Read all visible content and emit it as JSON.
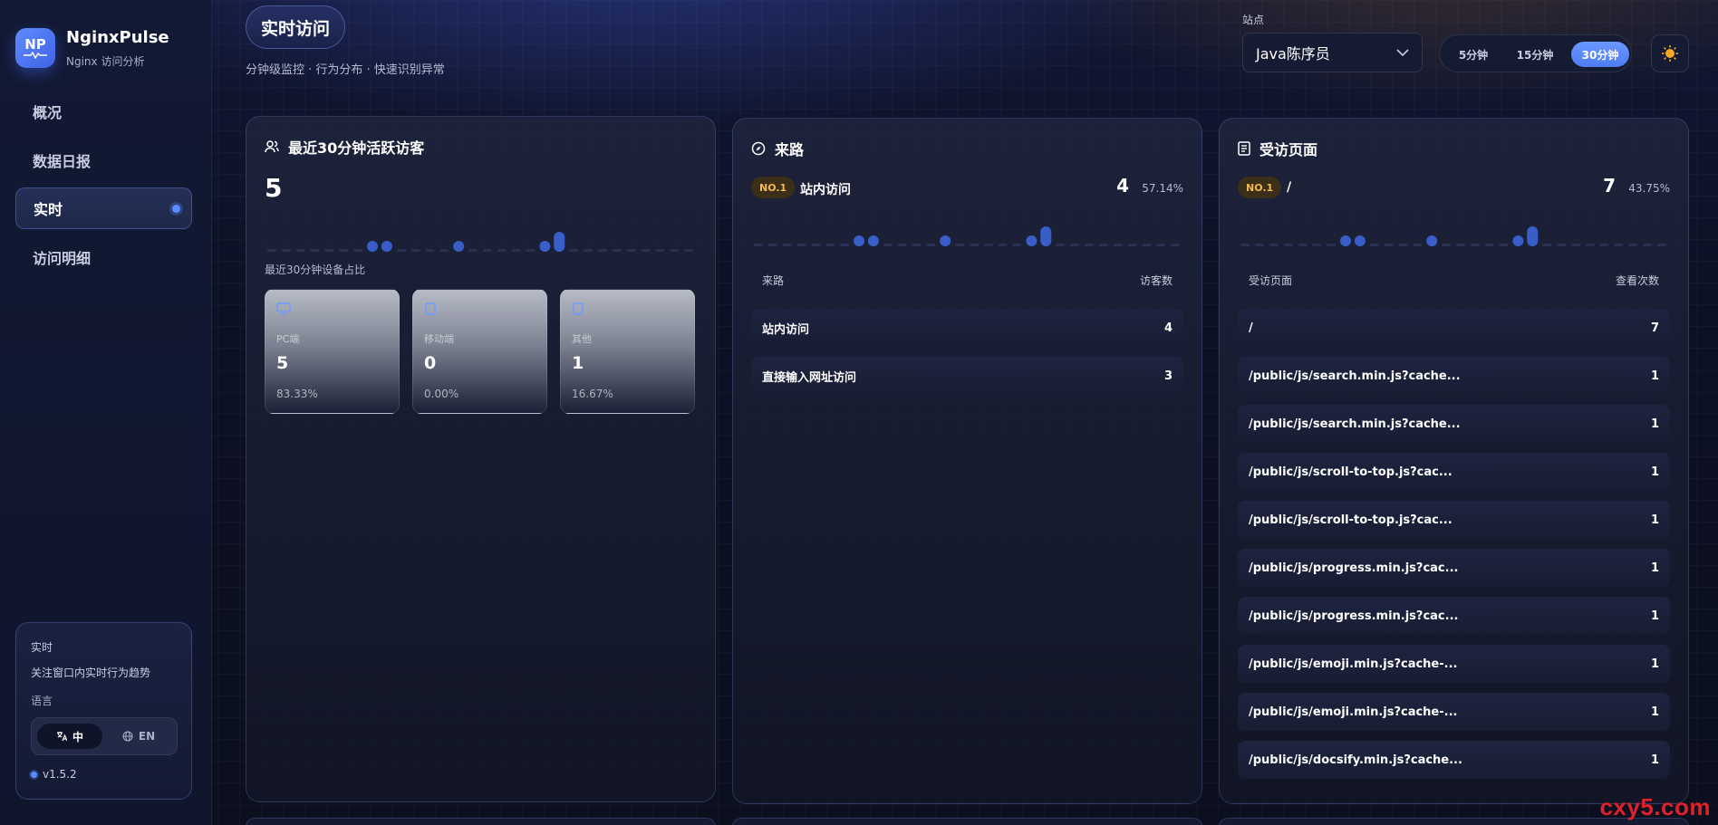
{
  "app": {
    "logo_abbr": "NP",
    "title": "NginxPulse",
    "subtitle": "Nginx 访问分析"
  },
  "nav": [
    {
      "label": "概况"
    },
    {
      "label": "数据日报"
    },
    {
      "label": "实时"
    },
    {
      "label": "访问明细"
    }
  ],
  "side_panel": {
    "title": "实时",
    "description": "关注窗口内实时行为趋势",
    "language_label": "语言",
    "lang_zh": "中",
    "lang_en": "EN",
    "version": "v1.5.2"
  },
  "header": {
    "title": "实时访问",
    "subtitle": "分钟级监控 · 行为分布 · 快速识别异常",
    "site_label": "站点",
    "site_value": "Java陈序员",
    "ranges": [
      "5分钟",
      "15分钟",
      "30分钟"
    ],
    "active_range": "30分钟"
  },
  "visitors_card": {
    "title": "最近30分钟活跃访客",
    "count": "5",
    "device_label": "最近30分钟设备占比",
    "devices": [
      {
        "label": "PC端",
        "count": "5",
        "pct": "83.33%"
      },
      {
        "label": "移动端",
        "count": "0",
        "pct": "0.00%"
      },
      {
        "label": "其他",
        "count": "1",
        "pct": "16.67%"
      }
    ]
  },
  "referrer_card": {
    "title": "来路",
    "top_badge": "NO.1",
    "top_name": "站内访问",
    "top_value": "4",
    "top_pct": "57.14%",
    "col_name": "来路",
    "col_value": "访客数",
    "rows": [
      {
        "name": "站内访问",
        "value": "4"
      },
      {
        "name": "直接输入网址访问",
        "value": "3"
      }
    ]
  },
  "pages_card": {
    "title": "受访页面",
    "top_badge": "NO.1",
    "top_name": "/",
    "top_value": "7",
    "top_pct": "43.75%",
    "col_name": "受访页面",
    "col_value": "查看次数",
    "rows": [
      {
        "name": "/",
        "value": "7"
      },
      {
        "name": "/public/js/search.min.js?cache...",
        "value": "1"
      },
      {
        "name": "/public/js/search.min.js?cache...",
        "value": "1"
      },
      {
        "name": "/public/js/scroll-to-top.js?cac...",
        "value": "1"
      },
      {
        "name": "/public/js/scroll-to-top.js?cac...",
        "value": "1"
      },
      {
        "name": "/public/js/progress.min.js?cac...",
        "value": "1"
      },
      {
        "name": "/public/js/progress.min.js?cac...",
        "value": "1"
      },
      {
        "name": "/public/js/emoji.min.js?cache-...",
        "value": "1"
      },
      {
        "name": "/public/js/emoji.min.js?cache-...",
        "value": "1"
      },
      {
        "name": "/public/js/docsify.min.js?cache...",
        "value": "1"
      }
    ]
  },
  "sparkline": {
    "values": [
      0,
      0,
      0,
      0,
      0,
      0,
      0,
      1,
      1,
      0,
      0,
      0,
      0,
      1,
      0,
      0,
      0,
      0,
      0,
      1,
      2,
      0,
      0,
      0,
      0,
      0,
      0,
      0,
      0,
      0
    ]
  },
  "watermark": "cxy5.com",
  "colors": {
    "accent": "#5b8cff",
    "badge": "#f3b94a",
    "bar": "#3a5ec8"
  }
}
